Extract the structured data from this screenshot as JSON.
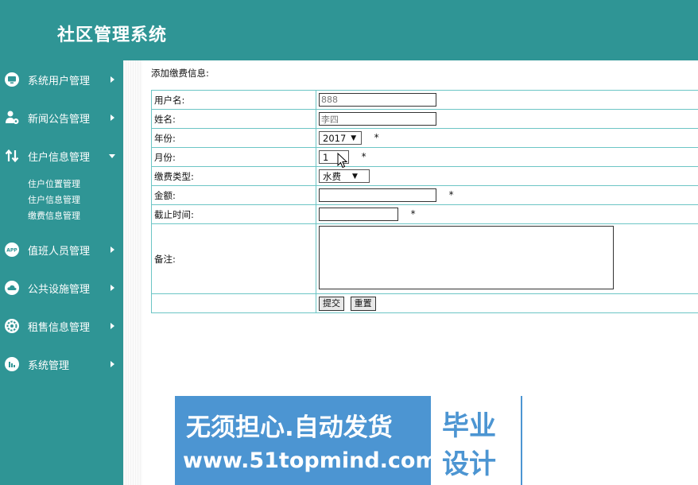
{
  "app": {
    "title": "社区管理系统"
  },
  "sidebar": {
    "items": [
      {
        "label": "系统用户管理",
        "icon": "monitor-icon",
        "expanded": false
      },
      {
        "label": "新闻公告管理",
        "icon": "user-gear-icon",
        "expanded": false
      },
      {
        "label": "住户信息管理",
        "icon": "transfer-arrows-icon",
        "expanded": true,
        "children": [
          "住户位置管理",
          "住户信息管理",
          "缴费信息管理"
        ]
      },
      {
        "label": "值班人员管理",
        "icon": "app-badge-icon",
        "icon_text": "APP",
        "expanded": false
      },
      {
        "label": "公共设施管理",
        "icon": "cloud-icon",
        "expanded": false
      },
      {
        "label": "租售信息管理",
        "icon": "settings-gear-icon",
        "expanded": false
      },
      {
        "label": "系统管理",
        "icon": "bar-chart-icon",
        "expanded": false
      }
    ]
  },
  "main": {
    "section_title": "添加缴费信息:",
    "form": {
      "username_label": "用户名:",
      "username_value": "888",
      "name_label": "姓名:",
      "name_value": "李四",
      "year_label": "年份:",
      "year_value": "2017",
      "month_label": "月份:",
      "month_value": "1",
      "type_label": "缴费类型:",
      "type_value": "水费",
      "amount_label": "金额:",
      "amount_value": "",
      "deadline_label": "截止时间:",
      "deadline_value": "",
      "remark_label": "备注:",
      "remark_value": "",
      "required_mark": "*",
      "submit_label": "提交",
      "reset_label": "重置"
    }
  },
  "banner": {
    "line1": "无须担心.自动发货",
    "line2": "www.51topmind.com",
    "box_line1": "毕业",
    "box_line2": "设计"
  },
  "colors": {
    "theme": "#2f9595",
    "table_border": "#6cc5c5",
    "banner_blue": "#4c95d2"
  }
}
